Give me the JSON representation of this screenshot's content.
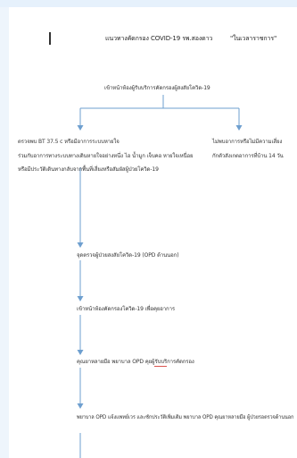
{
  "header": {
    "title": "แนวทางคัดกรอง COVID-19 รพ.สองดาว",
    "tag": "\"ในเวลาราชการ\""
  },
  "flow": {
    "start": "เข้าหน้าห้องผู้รับบริการคัดกรองผู้สงสัยโควิด-19",
    "left_branch": [
      "ตรวจพบ BT 37.5 c หรือมีอาการระบบหายใจ",
      "ร่วมกับอาการทางระบบทางเดินหายใจอย่างหนึ่ง ไอ น้ำมูก เจ็บคอ หายใจเหนื่อย",
      "หรือมีประวัติเดินทางกลับจากพื้นที่เสี่ยงหรือสัมผัสผู้ป่วยโควิด-19"
    ],
    "right_branch": [
      "ไม่พบอาการหรือไม่มีความเสี่ยง",
      "กักตัวสังเกตอาการที่บ้าน 14 วัน"
    ],
    "steps": [
      "จุดตรวจผู้ป่วยสงสัยโควิด-19 (OPD ด้านนอก)",
      "เข้าหน้าห้องคัดกรองโควิด-19 เพื่อคุยอาการ",
      "คุณยาหลายมือ พยาบาล OPD คุยผู้รับบริการคัดกรอง",
      "พยาบาล OPD แจ้งแพทย์เวร และซักประวัติเพิ่มเติม พยาบาล OPD คุณยาหลายมือ ผู้ป่วยรอตรวจด้านนอก"
    ]
  },
  "colors": {
    "arrow": "#6e9fcf",
    "top_band": "#e6f1fc",
    "underline": "#d9534f"
  }
}
